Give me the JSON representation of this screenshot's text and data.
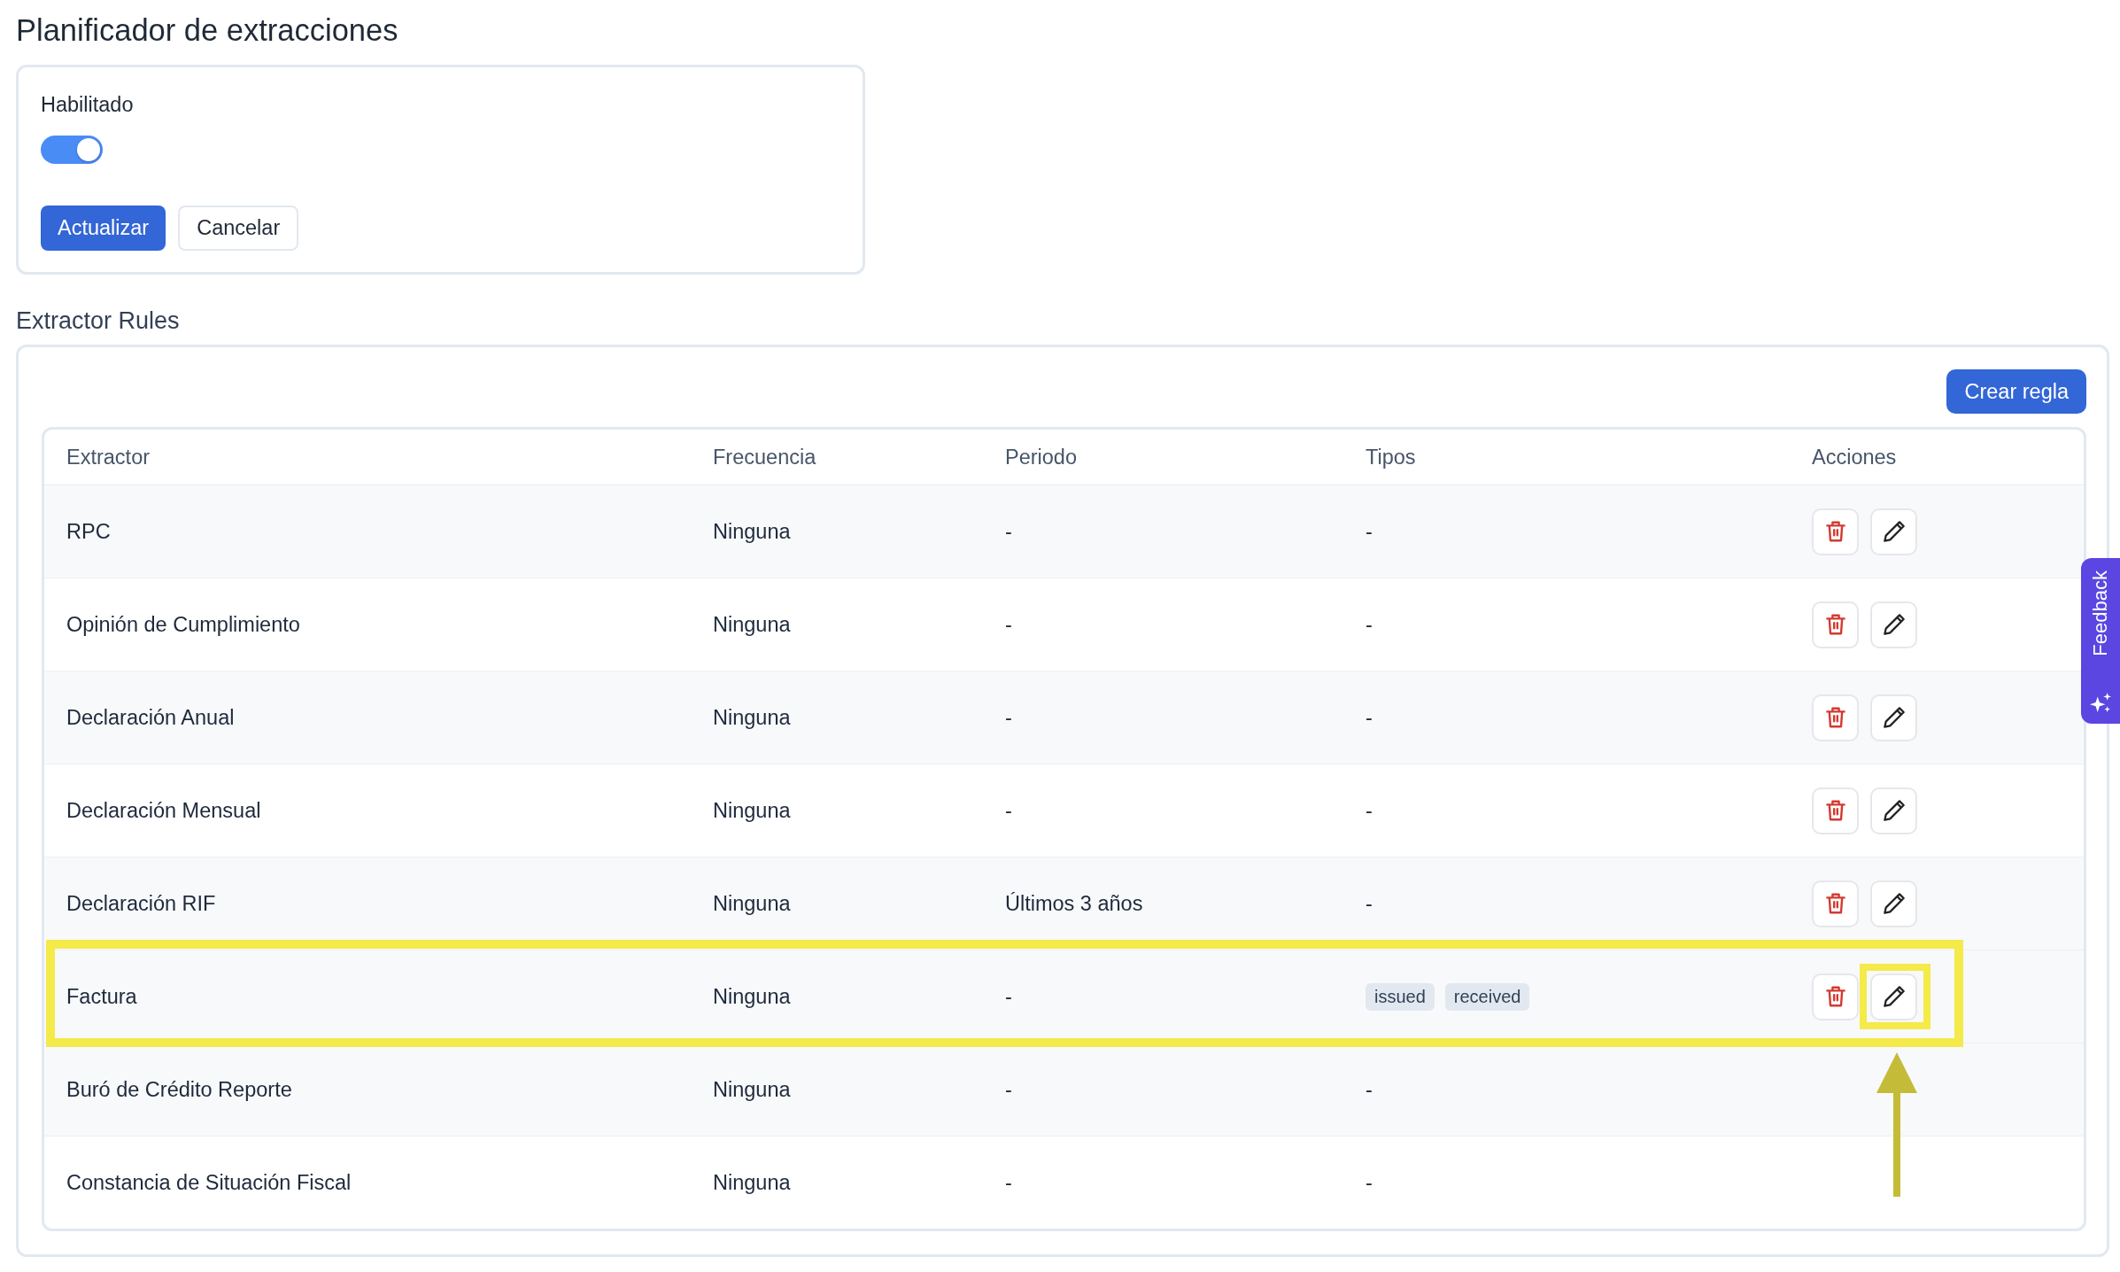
{
  "page": {
    "title": "Planificador de extracciones"
  },
  "scheduler": {
    "label": "Habilitado",
    "enabled": true,
    "buttons": [
      {
        "label": "Actualizar",
        "kind": "submit"
      },
      {
        "label": "Cancelar",
        "kind": "cancel"
      }
    ]
  },
  "rules": {
    "title": "Extractor Rules",
    "create_button": "Crear regla",
    "table": {
      "columns": [
        "Extractor",
        "Frecuencia",
        "Periodo",
        "Tipos",
        "Acciones"
      ],
      "rows": [
        {
          "extractor": "RPC",
          "frequency": "Ninguna",
          "period": "-",
          "types": {
            "kind": "text",
            "text": "-"
          },
          "actions": true,
          "highlighted": false,
          "edit_highlighted": false
        },
        {
          "extractor": "Opinión de Cumplimiento",
          "frequency": "Ninguna",
          "period": "-",
          "types": {
            "kind": "text",
            "text": "-"
          },
          "actions": true,
          "highlighted": false,
          "edit_highlighted": false
        },
        {
          "extractor": "Declaración Anual",
          "frequency": "Ninguna",
          "period": "-",
          "types": {
            "kind": "text",
            "text": "-"
          },
          "actions": true,
          "highlighted": false,
          "edit_highlighted": false
        },
        {
          "extractor": "Declaración Mensual",
          "frequency": "Ninguna",
          "period": "-",
          "types": {
            "kind": "text",
            "text": "-"
          },
          "actions": true,
          "highlighted": false,
          "edit_highlighted": false
        },
        {
          "extractor": "Declaración RIF",
          "frequency": "Ninguna",
          "period": "Últimos 3 años",
          "types": {
            "kind": "text",
            "text": "-"
          },
          "actions": true,
          "highlighted": false,
          "edit_highlighted": false
        },
        {
          "extractor": "Factura",
          "frequency": "Ninguna",
          "period": "-",
          "types": {
            "kind": "tags",
            "tags": [
              "issued",
              "received"
            ]
          },
          "actions": true,
          "highlighted": true,
          "edit_highlighted": true
        },
        {
          "extractor": "Buró de Crédito Reporte",
          "frequency": "Ninguna",
          "period": "-",
          "types": {
            "kind": "text",
            "text": "-"
          },
          "actions": false,
          "highlighted": false,
          "edit_highlighted": false
        },
        {
          "extractor": "Constancia de Situación Fiscal",
          "frequency": "Ninguna",
          "period": "-",
          "types": {
            "kind": "text",
            "text": "-"
          },
          "actions": false,
          "highlighted": false,
          "edit_highlighted": false
        }
      ]
    }
  },
  "feedback_tab": {
    "label": "Feedback"
  }
}
